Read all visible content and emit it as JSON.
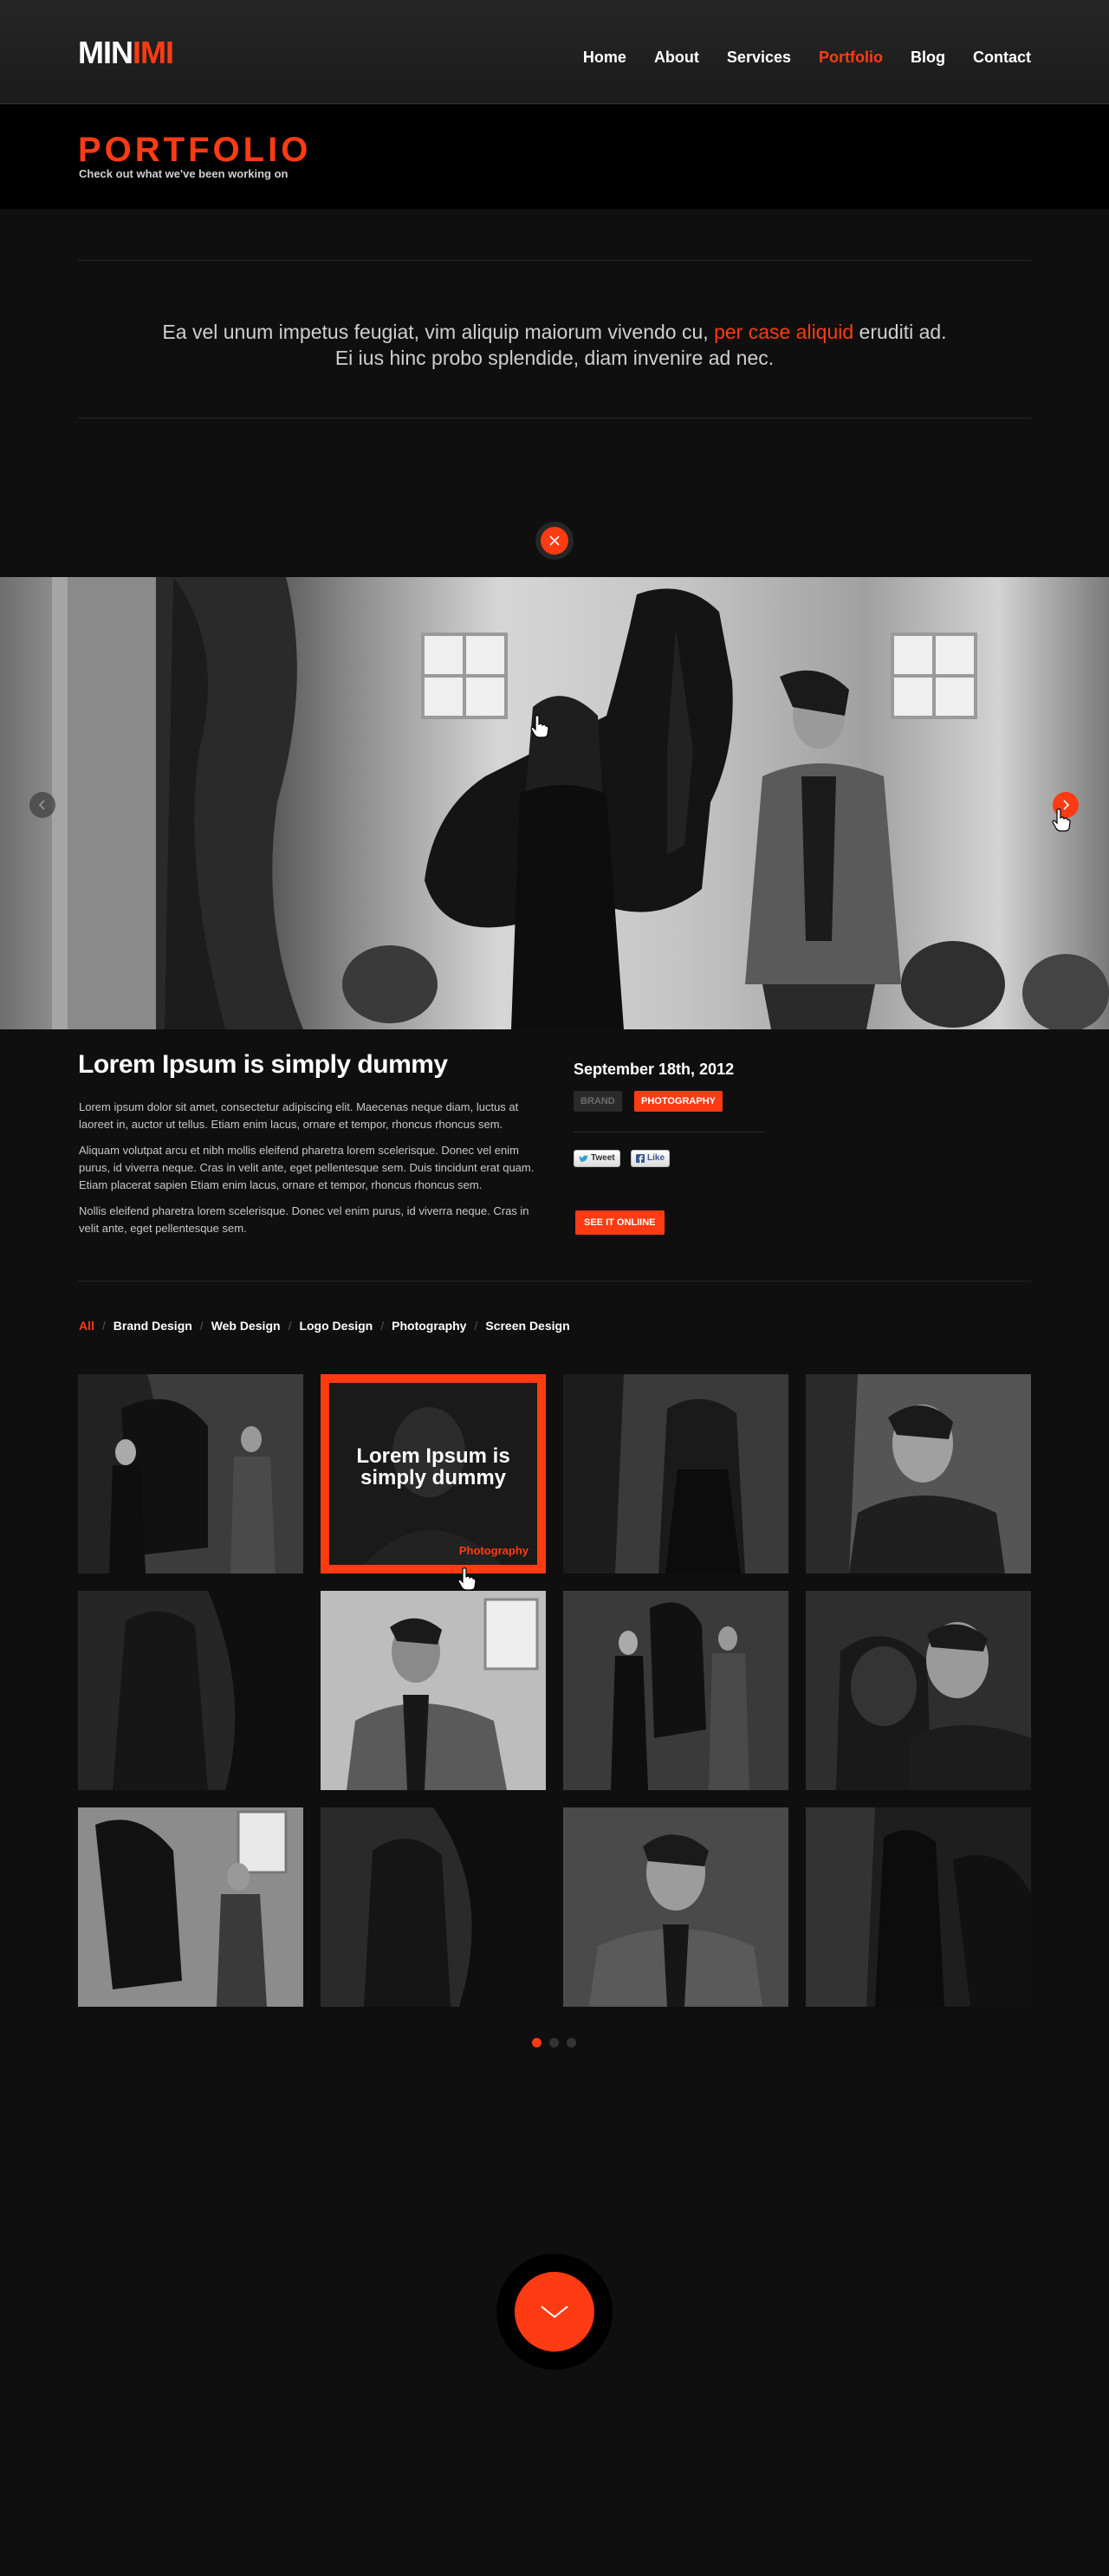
{
  "header": {
    "logo_part1": "MIN",
    "logo_part2": "IMI",
    "nav": [
      "Home",
      "About",
      "Services",
      "Portfolio",
      "Blog",
      "Contact"
    ],
    "active_nav": "Portfolio"
  },
  "page": {
    "title": "PORTFOLIO",
    "subtitle": "Check out what we've been working on"
  },
  "intro": {
    "line1_before": "Ea vel unum impetus feugiat, vim aliquip maiorum vivendo cu, ",
    "line1_highlight": "per case aliquid",
    "line1_after": " eruditi ad.",
    "line2": "Ei ius hinc probo splendide, diam invenire ad nec."
  },
  "hero": {
    "close_icon": "close-icon",
    "prev_icon": "chevron-left-icon",
    "next_icon": "chevron-right-icon"
  },
  "project": {
    "title": "Lorem Ipsum is simply dummy",
    "paragraphs": [
      "Lorem ipsum dolor sit amet, consectetur adipiscing elit. Maecenas neque diam, luctus at laoreet in, auctor ut tellus. Etiam enim lacus, ornare et tempor, rhoncus rhoncus sem.",
      "Aliquam volutpat arcu et nibh mollis eleifend pharetra lorem scelerisque. Donec vel enim purus, id viverra neque. Cras in velit ante, eget pellentesque sem. Duis tincidunt erat quam. Etiam placerat sapien Etiam enim lacus, ornare et tempor, rhoncus rhoncus sem.",
      "Nollis eleifend pharetra lorem scelerisque. Donec vel enim purus, id viverra neque. Cras in velit ante, eget pellentesque sem."
    ],
    "date": "September 18th, 2012",
    "tags": [
      "BRAND",
      "PHOTOGRAPHY"
    ],
    "tweet_label": "Tweet",
    "like_label": "Like",
    "see_online": "SEE IT ONLIINE"
  },
  "filters": {
    "items": [
      "All",
      "Brand Design",
      "Web Design",
      "Logo Design",
      "Photography",
      "Screen Design"
    ],
    "active": "All"
  },
  "grid": {
    "hover_title": "Lorem Ipsum is simply dummy",
    "hover_category": "Photography",
    "tile_count": 12
  },
  "pagination": {
    "pages": 3,
    "active": 1
  },
  "colors": {
    "accent": "#ff3b14",
    "background": "#0f0f0f"
  }
}
